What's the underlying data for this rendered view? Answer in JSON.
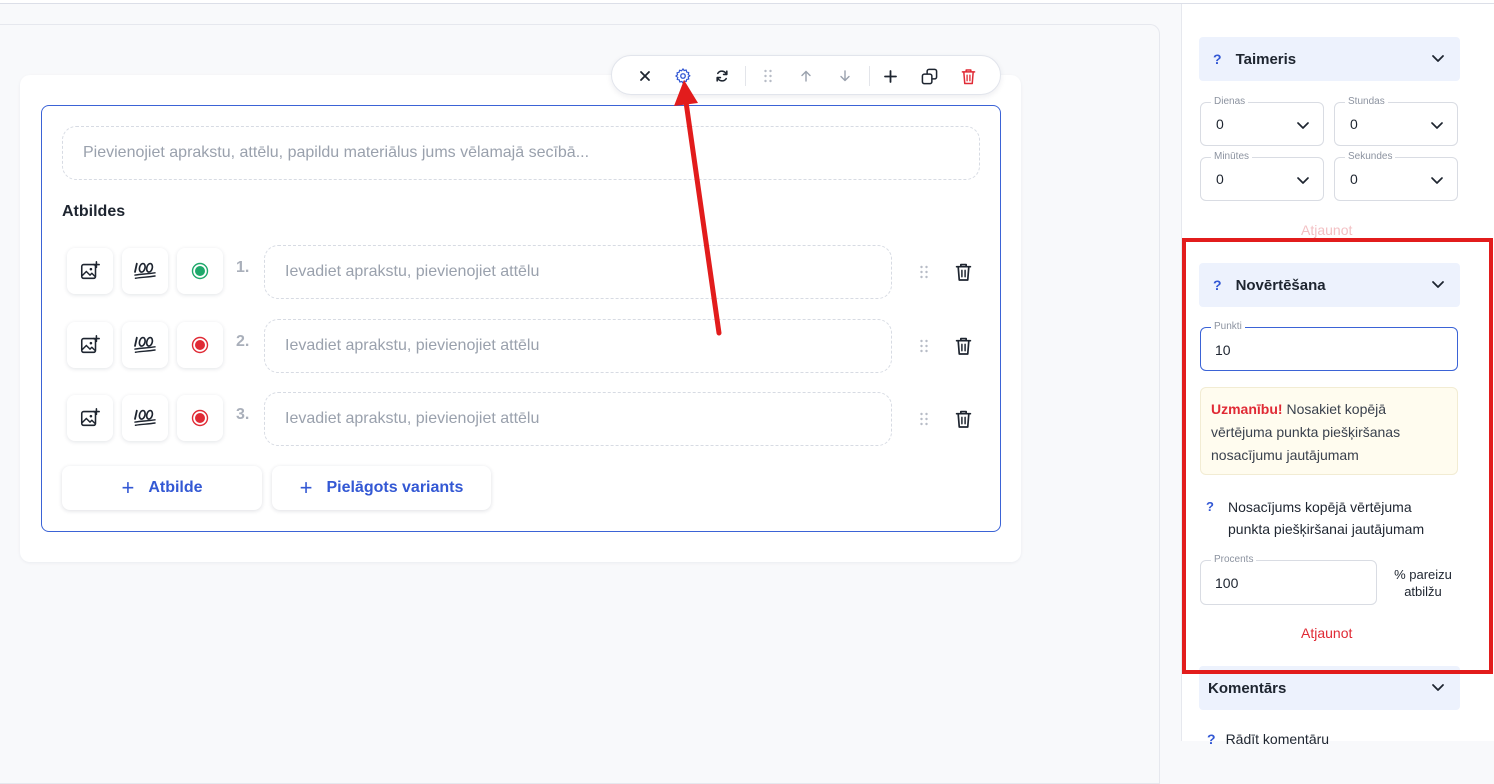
{
  "toolbar": {
    "icons": [
      "close-icon",
      "gear-icon",
      "sync-icon",
      "drag-icon",
      "arrow-up-icon",
      "arrow-down-icon",
      "plus-icon",
      "duplicate-icon",
      "trash-icon"
    ]
  },
  "question": {
    "description_placeholder": "Pievienojiet aprakstu, attēlu, papildu materiālus jums vēlamajā secībā...",
    "answers_title": "Atbildes",
    "answers": [
      {
        "number": "1.",
        "placeholder": "Ievadiet aprakstu, pievienojiet attēlu",
        "status_color": "#1fa86b"
      },
      {
        "number": "2.",
        "placeholder": "Ievadiet aprakstu, pievienojiet attēlu",
        "status_color": "#e02a35"
      },
      {
        "number": "3.",
        "placeholder": "Ievadiet aprakstu, pievienojiet attēlu",
        "status_color": "#e02a35"
      }
    ],
    "add_answer_label": "Atbilde",
    "add_custom_label": "Pielāgots variants"
  },
  "sidebar": {
    "timer": {
      "help": "?",
      "title": "Taimeris",
      "days_label": "Dienas",
      "days_value": "0",
      "hours_label": "Stundas",
      "hours_value": "0",
      "minutes_label": "Minūtes",
      "minutes_value": "0",
      "seconds_label": "Sekundes",
      "seconds_value": "0",
      "update_label": "Atjaunot"
    },
    "grading": {
      "help": "?",
      "title": "Novērtēšana",
      "points_label": "Punkti",
      "points_value": "10",
      "warning_strong": "Uzmanību!",
      "warning_text": " Nosakiet kopējā vērtējuma punkta piešķiršanas nosacījumu jautājumam",
      "condition_help": "?",
      "condition_text": "Nosacījums kopējā vērtējuma punkta piešķiršanai jautājumam",
      "percent_label": "Procents",
      "percent_value": "100",
      "percent_note": "% pareizu atbilžu",
      "update_label": "Atjaunot"
    },
    "comment": {
      "title": "Komentārs",
      "show_help": "?",
      "show_label": "Rādīt komentāru"
    }
  },
  "colors": {
    "accent": "#3358d4",
    "danger": "#e02a35",
    "highlight_box": "#e21c1c"
  }
}
